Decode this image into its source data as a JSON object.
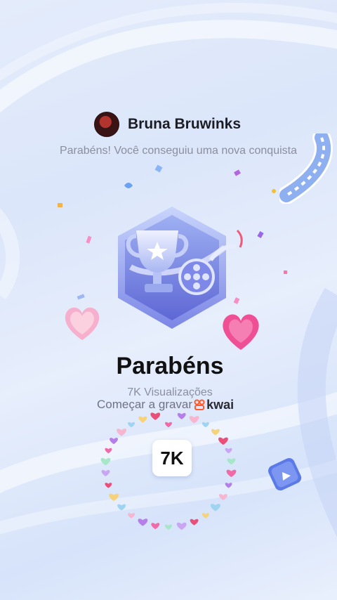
{
  "user": {
    "name": "Bruna Bruwinks"
  },
  "message": {
    "subtitle": "Parabéns! Você conseguiu uma nova conquista"
  },
  "achievement": {
    "title": "Parabéns",
    "views_label": "7K Visualizações",
    "count": "7K"
  },
  "cta": {
    "text": "Começar a gravar",
    "brand": "kwai"
  },
  "colors": {
    "badge_light": "#b9c7f4",
    "badge_dark": "#6b73d8",
    "heart_pink": "#f05a9a",
    "brand_orange": "#ff5a2c"
  }
}
